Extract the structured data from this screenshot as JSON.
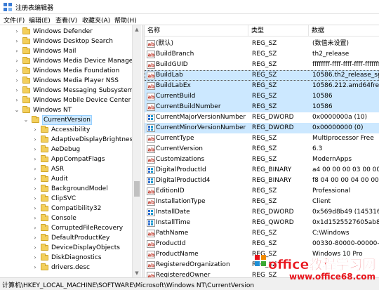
{
  "window": {
    "title": "注册表编辑器"
  },
  "menu": [
    {
      "label": "文件(F)"
    },
    {
      "label": "编辑(E)"
    },
    {
      "label": "查看(V)"
    },
    {
      "label": "收藏夹(A)"
    },
    {
      "label": "帮助(H)"
    }
  ],
  "tree": {
    "items": [
      {
        "label": "Windows Defender",
        "expander": "›",
        "indent": 0
      },
      {
        "label": "Windows Desktop Search",
        "expander": "›",
        "indent": 0
      },
      {
        "label": "Windows Mail",
        "expander": "›",
        "indent": 0
      },
      {
        "label": "Windows Media Device Manager",
        "expander": "›",
        "indent": 0
      },
      {
        "label": "Windows Media Foundation",
        "expander": "›",
        "indent": 0
      },
      {
        "label": "Windows Media Player NSS",
        "expander": "›",
        "indent": 0
      },
      {
        "label": "Windows Messaging Subsystem",
        "expander": "›",
        "indent": 0
      },
      {
        "label": "Windows Mobile Device Center",
        "expander": "›",
        "indent": 0
      },
      {
        "label": "Windows NT",
        "expander": "⌄",
        "indent": 0
      },
      {
        "label": "CurrentVersion",
        "expander": "⌄",
        "indent": 1,
        "selected": true
      },
      {
        "label": "Accessibility",
        "expander": "›",
        "indent": 2
      },
      {
        "label": "AdaptiveDisplayBrightness",
        "expander": "›",
        "indent": 2
      },
      {
        "label": "AeDebug",
        "expander": "›",
        "indent": 2
      },
      {
        "label": "AppCompatFlags",
        "expander": "›",
        "indent": 2
      },
      {
        "label": "ASR",
        "expander": "›",
        "indent": 2
      },
      {
        "label": "Audit",
        "expander": "›",
        "indent": 2
      },
      {
        "label": "BackgroundModel",
        "expander": "›",
        "indent": 2
      },
      {
        "label": "ClipSVC",
        "expander": "›",
        "indent": 2
      },
      {
        "label": "Compatibility32",
        "expander": "›",
        "indent": 2
      },
      {
        "label": "Console",
        "expander": "›",
        "indent": 2
      },
      {
        "label": "CorruptedFileRecovery",
        "expander": "›",
        "indent": 2
      },
      {
        "label": "DefaultProductKey",
        "expander": "›",
        "indent": 2
      },
      {
        "label": "DeviceDisplayObjects",
        "expander": "›",
        "indent": 2
      },
      {
        "label": "DiskDiagnostics",
        "expander": "›",
        "indent": 2
      },
      {
        "label": "drivers.desc",
        "expander": "›",
        "indent": 2
      }
    ]
  },
  "list": {
    "columns": {
      "name": "名称",
      "type": "类型",
      "data": "数据"
    },
    "rows": [
      {
        "icon": "string-value-icon",
        "name": "(默认)",
        "type": "REG_SZ",
        "data": "(数值未设置)"
      },
      {
        "icon": "string-value-icon",
        "name": "BuildBranch",
        "type": "REG_SZ",
        "data": "th2_release"
      },
      {
        "icon": "string-value-icon",
        "name": "BuildGUID",
        "type": "REG_SZ",
        "data": "ffffffff-ffff-ffff-ffff-ffffffffffff"
      },
      {
        "icon": "string-value-icon",
        "name": "BuildLab",
        "type": "REG_SZ",
        "data": "10586.th2_release_sec.1",
        "state": "focus"
      },
      {
        "icon": "string-value-icon",
        "name": "BuildLabEx",
        "type": "REG_SZ",
        "data": "10586.212.amd64fre.th2",
        "state": "sel"
      },
      {
        "icon": "string-value-icon",
        "name": "CurrentBuild",
        "type": "REG_SZ",
        "data": "10586",
        "state": "sel"
      },
      {
        "icon": "string-value-icon",
        "name": "CurrentBuildNumber",
        "type": "REG_SZ",
        "data": "10586",
        "state": "sel"
      },
      {
        "icon": "binary-value-icon",
        "name": "CurrentMajorVersionNumber",
        "type": "REG_DWORD",
        "data": "0x0000000a (10)"
      },
      {
        "icon": "binary-value-icon",
        "name": "CurrentMinorVersionNumber",
        "type": "REG_DWORD",
        "data": "0x00000000 (0)",
        "state": "sel"
      },
      {
        "icon": "string-value-icon",
        "name": "CurrentType",
        "type": "REG_SZ",
        "data": "Multiprocessor Free"
      },
      {
        "icon": "string-value-icon",
        "name": "CurrentVersion",
        "type": "REG_SZ",
        "data": "6.3"
      },
      {
        "icon": "string-value-icon",
        "name": "Customizations",
        "type": "REG_SZ",
        "data": "ModernApps"
      },
      {
        "icon": "binary-value-icon",
        "name": "DigitalProductId",
        "type": "REG_BINARY",
        "data": "a4 00 00 00 03 00 00 00"
      },
      {
        "icon": "binary-value-icon",
        "name": "DigitalProductId4",
        "type": "REG_BINARY",
        "data": "f8 04 00 00 04 00 00 00"
      },
      {
        "icon": "string-value-icon",
        "name": "EditionID",
        "type": "REG_SZ",
        "data": "Professional"
      },
      {
        "icon": "string-value-icon",
        "name": "InstallationType",
        "type": "REG_SZ",
        "data": "Client"
      },
      {
        "icon": "binary-value-icon",
        "name": "InstallDate",
        "type": "REG_DWORD",
        "data": "0x569d8b49 (14531653"
      },
      {
        "icon": "binary-value-icon",
        "name": "InstallTime",
        "type": "REG_QWORD",
        "data": "0x1d1525527605ab8 (1"
      },
      {
        "icon": "string-value-icon",
        "name": "PathName",
        "type": "REG_SZ",
        "data": "C:\\Windows"
      },
      {
        "icon": "string-value-icon",
        "name": "ProductId",
        "type": "REG_SZ",
        "data": "00330-80000-00000-AA"
      },
      {
        "icon": "string-value-icon",
        "name": "ProductName",
        "type": "REG_SZ",
        "data": "Windows 10 Pro"
      },
      {
        "icon": "string-value-icon",
        "name": "RegisteredOrganization",
        "type": "REG_SZ",
        "data": ""
      },
      {
        "icon": "string-value-icon",
        "name": "RegisteredOwner",
        "type": "REG_SZ",
        "data": ""
      }
    ]
  },
  "status": {
    "path": "计算机\\HKEY_LOCAL_MACHINE\\SOFTWARE\\Microsoft\\Windows NT\\CurrentVersion"
  },
  "watermark": {
    "line1": "office教程学习网",
    "line2": "www.office68.com"
  },
  "colors": {
    "selection": "#cce8ff",
    "folder": "#f3cf5c",
    "watermark_red": "#e8141c"
  }
}
